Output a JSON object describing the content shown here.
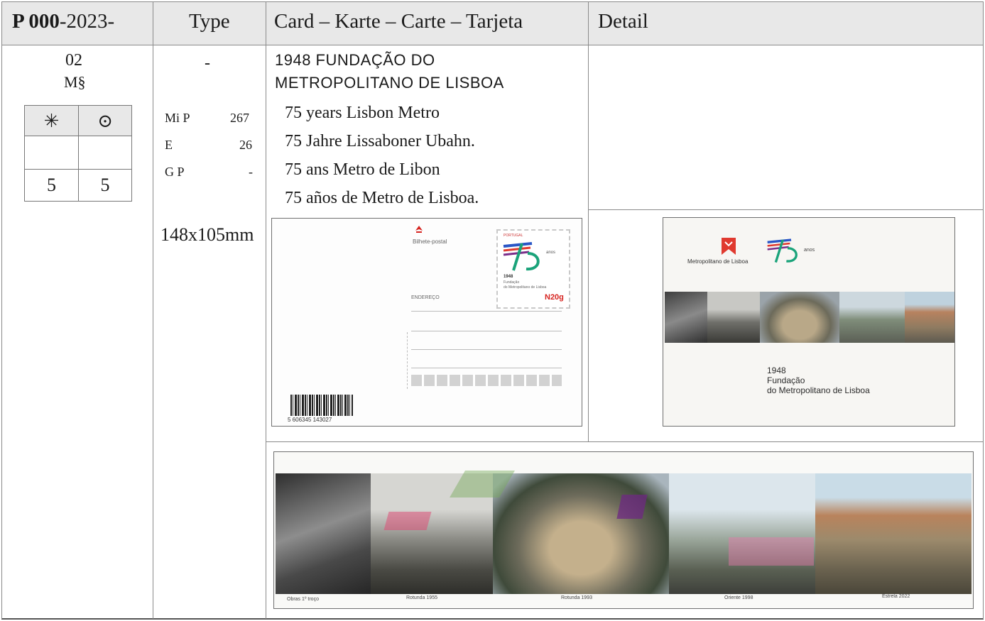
{
  "header": {
    "col1_bold": "P 000",
    "col1_rest": "-2023-",
    "col2": "Type",
    "col3": "Card – Karte – Carte – Tarjeta",
    "col4": "Detail"
  },
  "left_col": {
    "number": "02",
    "ms": "M§",
    "symbols": {
      "mint": "✳",
      "used": "⊙"
    },
    "values": {
      "mint": "5",
      "used": "5"
    }
  },
  "type_col": {
    "dash": "-",
    "catalogs": [
      {
        "name": "Mi  P",
        "value": "267"
      },
      {
        "name": "E",
        "value": "26"
      },
      {
        "name": "G  P",
        "value": "-"
      }
    ],
    "size": "148x105mm"
  },
  "card": {
    "title_line1": "1948 FUNDAÇÃO DO",
    "title_line2": "METROPOLITANO DE LISBOA",
    "lines": [
      "75 years Lisbon Metro",
      "75 Jahre Lissaboner Ubahn.",
      "75 ans Metro de Libon",
      "75 años de Metro de Lisboa."
    ]
  },
  "postcard": {
    "label": "Bilhete-postal",
    "address_label": "ENDEREÇO",
    "stamp_country": "PORTUGAL",
    "stamp_year": "1948",
    "stamp_line1": "Fundação",
    "stamp_line2": "do Metropolitano de Lisboa",
    "stamp_value": "N20g",
    "stamp_anos": "anos",
    "barcode_number": "5 606345 143027"
  },
  "detail": {
    "brand": "Metropolitano de Lisboa",
    "anos": "anos",
    "year": "1948",
    "line1": "Fundação",
    "line2": "do Metropolitano de Lisboa"
  },
  "strip_captions": [
    "Obras 1º troço",
    "Rotunda 1955",
    "Rotunda 1993",
    "Oriente 1998",
    "Estrela 2022"
  ],
  "colors": {
    "header_bg": "#e8e8e8",
    "grid": "#8a8a8a",
    "brand_red": "#e03a2f",
    "logo_blue": "#2a56c6",
    "logo_green": "#1aa37a",
    "logo_purple": "#7b2e8a"
  }
}
